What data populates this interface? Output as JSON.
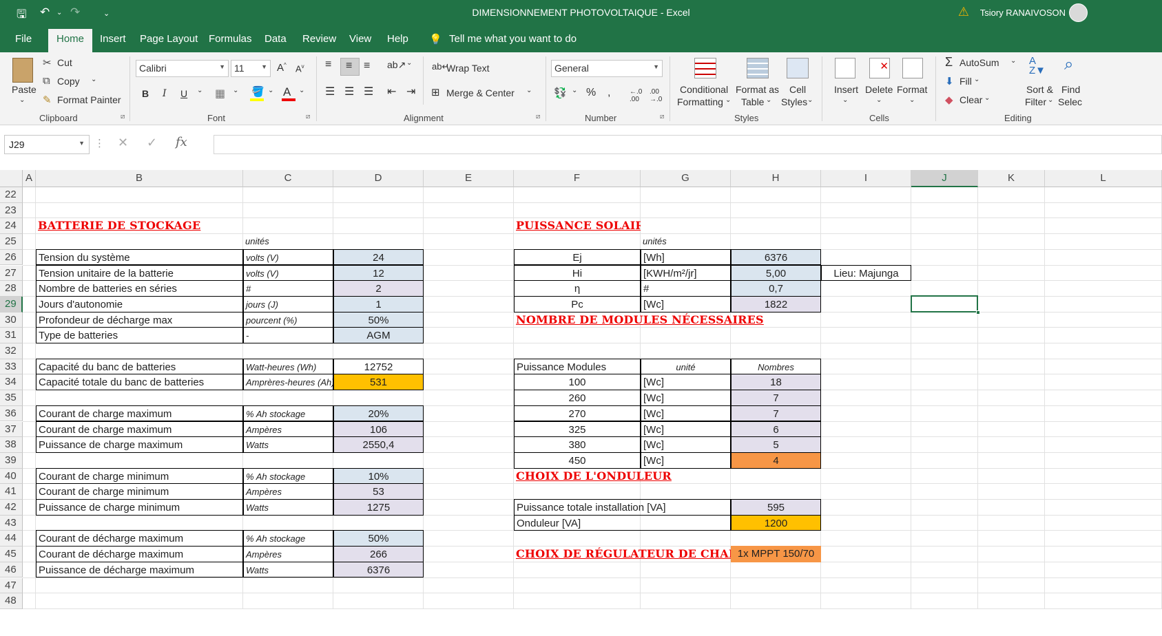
{
  "window": {
    "title": "DIMENSIONNEMENT PHOTOVOLTAIQUE  -  Excel",
    "user": "Tsiory RANAIVOSON"
  },
  "menu": {
    "tabs": [
      "File",
      "Home",
      "Insert",
      "Page Layout",
      "Formulas",
      "Data",
      "Review",
      "View",
      "Help"
    ],
    "tell_me": "Tell me what you want to do"
  },
  "ribbon": {
    "paste": "Paste",
    "cut": "Cut",
    "copy": "Copy",
    "format_painter": "Format Painter",
    "clipboard": "Clipboard",
    "font_name": "Calibri",
    "font_size": "11",
    "font": "Font",
    "wrap_text": "Wrap Text",
    "merge_center": "Merge & Center",
    "alignment": "Alignment",
    "number_format": "General",
    "number": "Number",
    "conditional_1": "Conditional",
    "conditional_2": "Formatting",
    "format_as_1": "Format as",
    "format_as_2": "Table",
    "cell_styles_1": "Cell",
    "cell_styles_2": "Styles",
    "styles": "Styles",
    "insert": "Insert",
    "delete": "Delete",
    "format": "Format",
    "cells": "Cells",
    "autosum": "AutoSum",
    "fill": "Fill",
    "clear": "Clear",
    "sort_1": "Sort &",
    "sort_2": "Filter",
    "find_1": "Find",
    "find_2": "Selec",
    "editing": "Editing"
  },
  "formula_bar": {
    "name_box": "J29",
    "formula": ""
  },
  "columns": [
    "A",
    "B",
    "C",
    "D",
    "E",
    "F",
    "G",
    "H",
    "I",
    "J",
    "K",
    "L"
  ],
  "selected_column": "J",
  "rows": [
    "22",
    "23",
    "24",
    "25",
    "26",
    "27",
    "28",
    "29",
    "30",
    "31",
    "32",
    "33",
    "34",
    "35",
    "36",
    "37",
    "38",
    "39",
    "40",
    "41",
    "42",
    "43",
    "44",
    "45",
    "46",
    "47",
    "48"
  ],
  "selected_row": "29",
  "batterie": {
    "title": "BATTERIE DE STOCKAGE",
    "unit_header": "unités",
    "params": [
      {
        "label": "Tension du système",
        "unit": "volts (V)",
        "value": "24"
      },
      {
        "label": "Tension unitaire de la batterie",
        "unit": "volts (V)",
        "value": "12"
      },
      {
        "label": "Nombre de batteries en séries",
        "unit": "#",
        "value": "2"
      },
      {
        "label": "Jours d'autonomie",
        "unit": "jours (J)",
        "value": "1"
      },
      {
        "label": "Profondeur de décharge max",
        "unit": "pourcent (%)",
        "value": "50%"
      },
      {
        "label": "Type de batteries",
        "unit": "-",
        "value": "AGM"
      }
    ],
    "capacity": [
      {
        "label": "Capacité du banc de batteries",
        "unit": "Watt-heures (Wh)",
        "value": "12752"
      },
      {
        "label": "Capacité totale du banc de batteries",
        "unit": "Amprères-heures (Ah)",
        "value": "531"
      }
    ],
    "charge_max": [
      {
        "label": "Courant de charge maximum",
        "unit": "% Ah stockage",
        "value": "20%"
      },
      {
        "label": "Courant de charge maximum",
        "unit": "Ampères",
        "value": "106"
      },
      {
        "label": "Puissance de charge maximum",
        "unit": "Watts",
        "value": "2550,4"
      }
    ],
    "charge_min": [
      {
        "label": "Courant de charge minimum",
        "unit": "% Ah stockage",
        "value": "10%"
      },
      {
        "label": "Courant de charge minimum",
        "unit": "Ampères",
        "value": "53"
      },
      {
        "label": "Puissance de charge minimum",
        "unit": "Watts",
        "value": "1275"
      }
    ],
    "decharge_max": [
      {
        "label": "Courant de décharge maximum",
        "unit": "% Ah stockage",
        "value": "50%"
      },
      {
        "label": "Courant de décharge maximum",
        "unit": "Ampères",
        "value": "266"
      },
      {
        "label": "Puissance de décharge maximum",
        "unit": "Watts",
        "value": "6376"
      }
    ]
  },
  "solaire": {
    "title": "PUISSANCE SOLAIRE",
    "unit_header": "unités",
    "rows": [
      {
        "label": "Ej",
        "unit": "[Wh]",
        "value": "6376"
      },
      {
        "label": "Hi",
        "unit": "[KWH/m²/jr]",
        "value": "5,00"
      },
      {
        "label": "η",
        "unit": "#",
        "value": "0,7"
      },
      {
        "label": "Pc",
        "unit": "[Wc]",
        "value": "1822"
      }
    ],
    "lieu": "Lieu: Majunga"
  },
  "modules": {
    "title": "NOMBRE DE MODULES NÉCESSAIRES",
    "headers": [
      "Puissance Modules",
      "unité",
      "Nombres"
    ],
    "rows": [
      {
        "p": "100",
        "u": "[Wc]",
        "n": "18"
      },
      {
        "p": "260",
        "u": "[Wc]",
        "n": "7"
      },
      {
        "p": "270",
        "u": "[Wc]",
        "n": "7"
      },
      {
        "p": "325",
        "u": "[Wc]",
        "n": "6"
      },
      {
        "p": "380",
        "u": "[Wc]",
        "n": "5"
      },
      {
        "p": "450",
        "u": "[Wc]",
        "n": "4"
      }
    ]
  },
  "onduleur": {
    "title": "CHOIX DE L'ONDULEUR",
    "total_label": "Puissance totale installation [VA]",
    "total_value": "595",
    "ond_label": "Onduleur [VA]",
    "ond_value": "1200"
  },
  "regulateur": {
    "title": "CHOIX DE RÉGULATEUR DE CHARGE",
    "value": "1x MPPT 150/70"
  }
}
